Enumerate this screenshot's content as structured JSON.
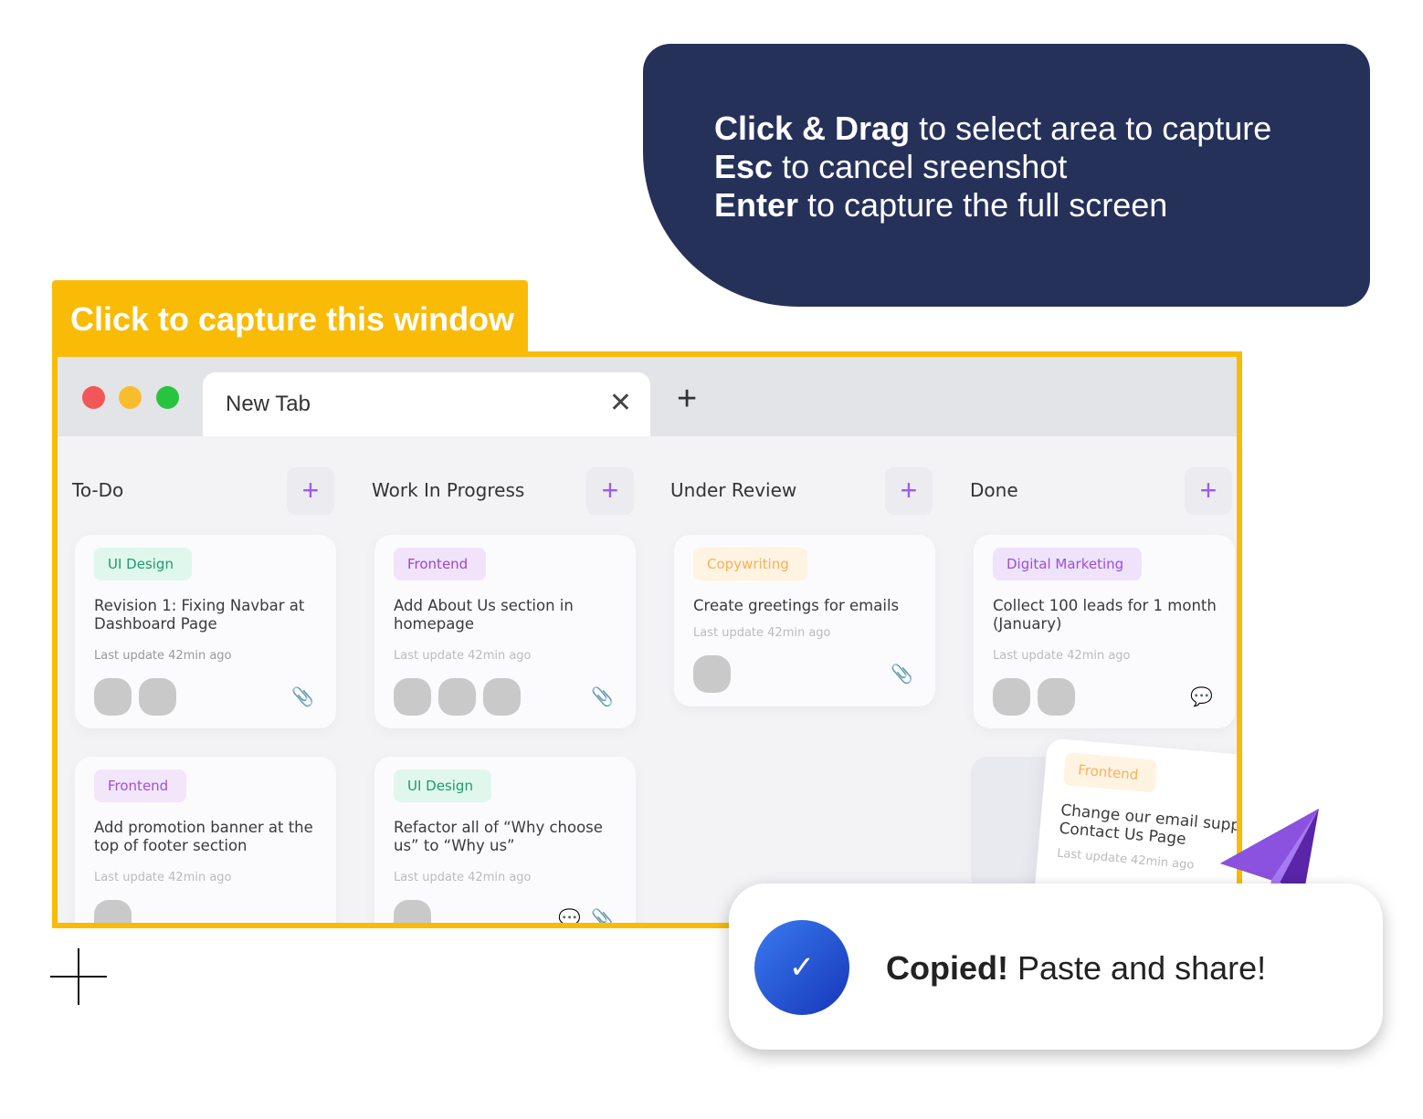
{
  "tooltip": {
    "lines": [
      {
        "bold": "Click & Drag",
        "rest": " to select area to capture"
      },
      {
        "bold": "Esc",
        "rest": " to cancel sreenshot"
      },
      {
        "bold": "Enter",
        "rest": " to capture the full screen"
      }
    ]
  },
  "capture_label": "Click to capture this window",
  "browser": {
    "tab_title": "New Tab",
    "close_glyph": "✕",
    "new_tab_glyph": "+"
  },
  "colors": {
    "accent": "#f9bb06",
    "navy": "#26315a",
    "plus": "#9b5de5"
  },
  "columns": [
    {
      "title": "To-Do",
      "cards": [
        {
          "tag": "UI Design",
          "title": "Revision 1: Fixing Navbar at Dashboard Page",
          "updated": "Last update 42min ago"
        },
        {
          "tag": "Frontend",
          "title": "Add promotion banner at the top of footer section",
          "updated": "Last update 42min ago"
        }
      ]
    },
    {
      "title": "Work In Progress",
      "cards": [
        {
          "tag": "Frontend",
          "title": "Add About Us section in homepage",
          "updated": "Last update 42min ago"
        },
        {
          "tag": "UI Design",
          "title": "Refactor all of “Why choose us” to “Why us”",
          "updated": "Last update 42min ago"
        }
      ]
    },
    {
      "title": "Under Review",
      "cards": [
        {
          "tag": "Copywriting",
          "title": "Create greetings for emails",
          "updated": "Last update 42min ago"
        }
      ]
    },
    {
      "title": "Done",
      "cards": [
        {
          "tag": "Digital Marketing",
          "title": "Collect 100 leads for 1 month (January)",
          "updated": "Last update 42min ago"
        },
        {
          "tag": "Frontend",
          "title": "Change our email support at Contact Us Page",
          "updated": "Last update 42min ago"
        }
      ]
    }
  ],
  "toast": {
    "bold": "Copied!",
    "rest": " Paste and share!"
  }
}
